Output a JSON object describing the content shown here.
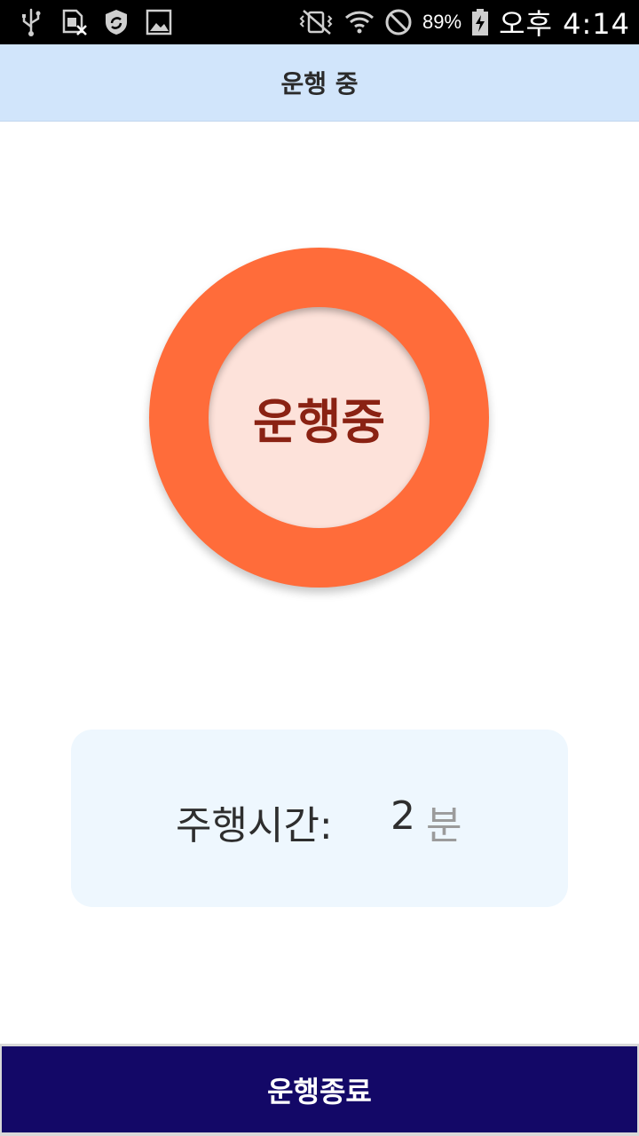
{
  "status_bar": {
    "icons_left": [
      "usb-icon",
      "sim-card-error-icon",
      "shield-sync-icon",
      "image-icon"
    ],
    "icons_right": [
      "vibrate-icon",
      "wifi-icon",
      "do-not-disturb-icon",
      "battery-charging-icon"
    ],
    "battery_percent": "89%",
    "time": "오후 4:14"
  },
  "header": {
    "title": "운행 중"
  },
  "status_circle": {
    "label": "운행중",
    "ring_color": "#ff6c3a",
    "inner_color": "#fde2da",
    "text_color": "#8a2213"
  },
  "driving_time": {
    "label": "주행시간:",
    "value": "2",
    "unit": "분"
  },
  "end_button": {
    "label": "운행종료",
    "color": "#130867"
  },
  "colors": {
    "header_bg": "#d1e5fb",
    "card_bg": "#eef7fe"
  }
}
